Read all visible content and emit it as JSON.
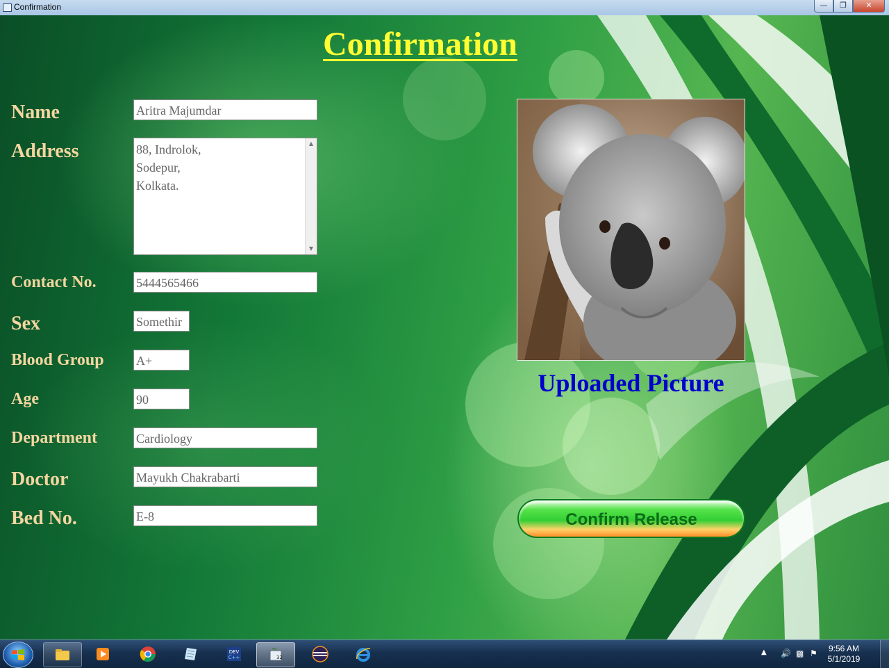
{
  "window": {
    "title": "Confirmation",
    "controls": [
      "minimize",
      "maximize",
      "close"
    ]
  },
  "page": {
    "heading": "Confirmation"
  },
  "form": {
    "name": {
      "label": "Name",
      "value": "Aritra Majumdar"
    },
    "address": {
      "label": "Address",
      "lines": [
        "88, Indrolok,",
        "Sodepur,",
        "Kolkata."
      ]
    },
    "contact": {
      "label": "Contact No.",
      "value": "5444565466"
    },
    "sex": {
      "label": "Sex",
      "value": "Somethir"
    },
    "blood_group": {
      "label": "Blood Group",
      "value": "A+"
    },
    "age": {
      "label": "Age",
      "value": "90"
    },
    "department": {
      "label": "Department",
      "value": "Cardiology"
    },
    "doctor": {
      "label": "Doctor",
      "value": "Mayukh Chakrabarti"
    },
    "bed_no": {
      "label": "Bed No.",
      "value": "E-8"
    }
  },
  "picture": {
    "caption": "Uploaded Picture",
    "subject": "koala"
  },
  "actions": {
    "confirm_label": "Confirm Release"
  },
  "taskbar": {
    "apps": [
      "file-explorer-icon",
      "media-player-icon",
      "chrome-icon",
      "notepad-icon",
      "devcpp-icon",
      "java-app-icon",
      "eclipse-icon",
      "internet-explorer-icon"
    ],
    "clock_time": "9:56 AM",
    "clock_date": "5/1/2019"
  },
  "colors": {
    "label": "#f4d6a0",
    "heading": "#ffff33",
    "caption": "#0000cc",
    "button_text": "#0b6b17"
  }
}
